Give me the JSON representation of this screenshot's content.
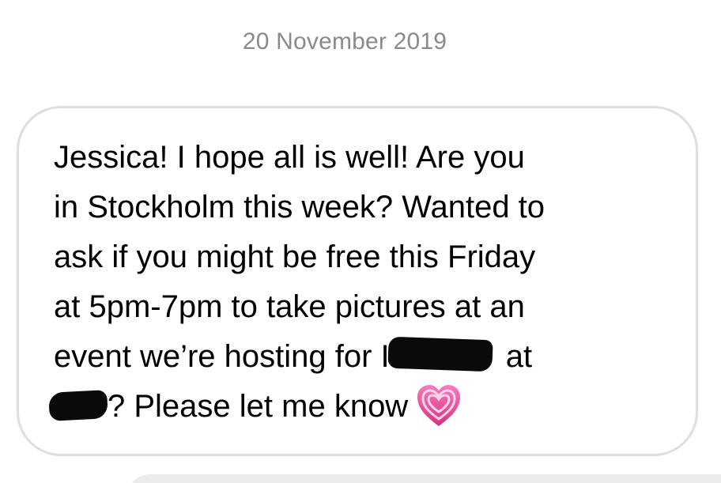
{
  "conversation": {
    "timestamp": "20 November 2019",
    "message": {
      "lines": [
        "Jessica! I hope all is well! Are you",
        "in Stockholm this week? Wanted to",
        "ask if you might be free this Friday",
        "at 5pm-7pm to take pictures at an"
      ],
      "line5_start": "event we’re hosting for I",
      "line5_end": " at",
      "line6_end": "? Please let me know",
      "emoji_icon": "growing-heart-icon",
      "redaction_color": "#0a0a0a"
    }
  },
  "colors": {
    "timestamp": "#8a8a8e",
    "bubble_border": "#dedede",
    "heart_pink": "#e6479c",
    "heart_light": "#f6b6d8"
  }
}
